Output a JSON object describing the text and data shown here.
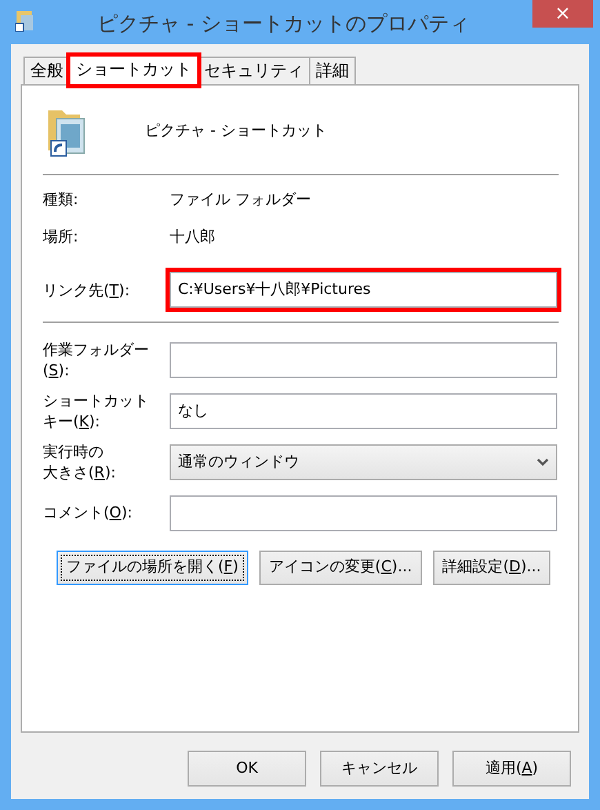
{
  "window": {
    "title": "ピクチャ - ショートカットのプロパティ",
    "close": "×"
  },
  "tabs": [
    {
      "label": "全般",
      "selected": false,
      "highlighted": false
    },
    {
      "label": "ショートカット",
      "selected": true,
      "highlighted": true
    },
    {
      "label": "セキュリティ",
      "selected": false,
      "highlighted": false
    },
    {
      "label": "詳細",
      "selected": false,
      "highlighted": false
    }
  ],
  "shortcut_name": "ピクチャ - ショートカット",
  "info": [
    {
      "label": "種類:",
      "value": "ファイル フォルダー"
    },
    {
      "label": "場所:",
      "value": "十八郎"
    }
  ],
  "target": {
    "label": {
      "before": [
        "リンク先("
      ],
      "key": "T",
      "after": "):"
    },
    "value": "C:¥Users¥十八郎¥Pictures",
    "highlighted": true
  },
  "fields": [
    {
      "kind": "text",
      "label": {
        "before": [
          "作業フォルダー",
          "("
        ],
        "key": "S",
        "after": "):"
      }
    },
    {
      "kind": "text",
      "label": {
        "before": [
          "ショートカット",
          "キー("
        ],
        "key": "K",
        "after": "):"
      },
      "value": "なし"
    },
    {
      "kind": "select",
      "label": {
        "before": [
          "実行時の",
          "大きさ("
        ],
        "key": "R",
        "after": "):"
      },
      "value": "通常のウィンドウ"
    },
    {
      "kind": "text",
      "label": {
        "before": [
          "コメント("
        ],
        "key": "O",
        "after": "):"
      }
    }
  ],
  "actions": [
    {
      "label": {
        "before": [
          "ファイルの場所を開く("
        ],
        "key": "F",
        "after": ")"
      },
      "focused": true
    },
    {
      "label": {
        "before": [
          "アイコンの変更("
        ],
        "key": "C",
        "after": ")..."
      },
      "focused": false
    },
    {
      "label": {
        "before": [
          "詳細設定("
        ],
        "key": "D",
        "after": ")..."
      },
      "focused": false
    }
  ],
  "buttons": [
    {
      "label": {
        "before": [
          "OK"
        ]
      }
    },
    {
      "label": {
        "before": [
          "キャンセル"
        ]
      }
    },
    {
      "label": {
        "before": [
          "適用("
        ],
        "key": "A",
        "after": ")"
      }
    }
  ]
}
